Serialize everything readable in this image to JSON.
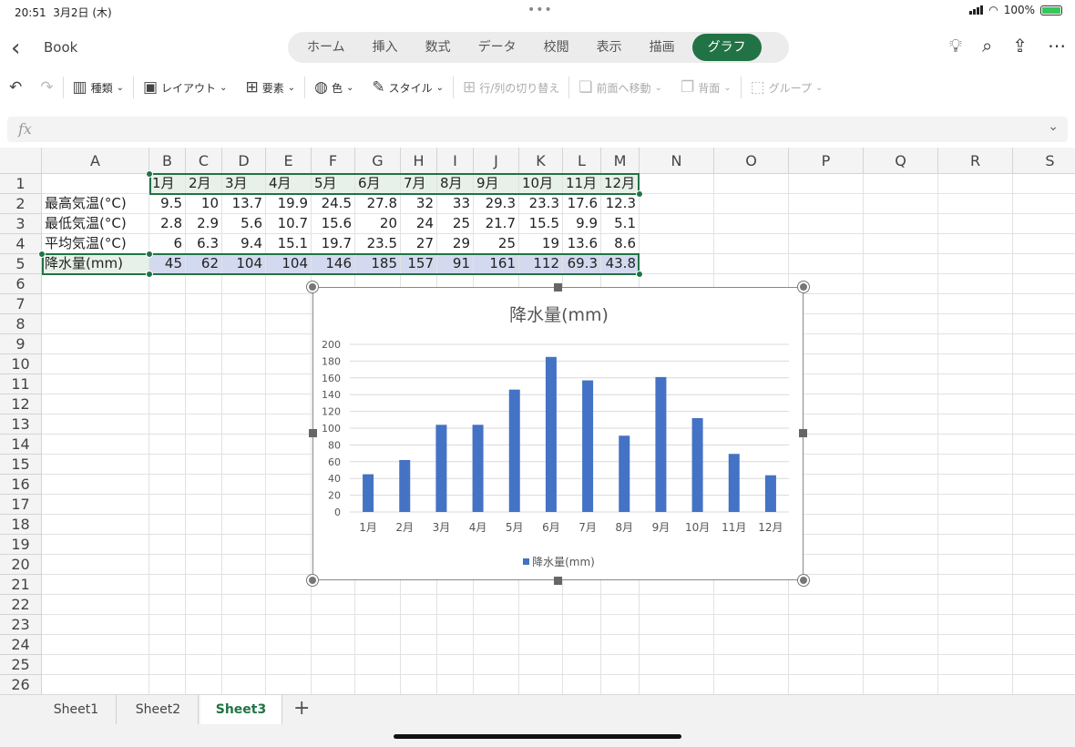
{
  "status": {
    "time": "20:51",
    "date": "3月2日 (木)",
    "battery": "100%",
    "dots": "•••"
  },
  "header": {
    "back_icon": "chevron-left-icon",
    "title": "Book",
    "tabs": [
      "ホーム",
      "挿入",
      "数式",
      "データ",
      "校閲",
      "表示",
      "描画",
      "グラフ"
    ],
    "active_tab": "グラフ",
    "right_icons": [
      "lightbulb-icon",
      "search-icon",
      "share-icon",
      "more-icon"
    ]
  },
  "ribbon": {
    "undo_icon": "undo-icon",
    "redo_icon": "redo-icon",
    "items": [
      {
        "label": "種類",
        "icon": "chart-type-icon",
        "enabled": true
      },
      {
        "label": "レイアウト",
        "icon": "layout-icon",
        "enabled": true
      },
      {
        "label": "要素",
        "icon": "elements-icon",
        "enabled": true
      },
      {
        "label": "色",
        "icon": "palette-icon",
        "enabled": true
      },
      {
        "label": "スタイル",
        "icon": "style-icon",
        "enabled": true
      },
      {
        "label": "行/列の切り替え",
        "icon": "switch-row-col-icon",
        "enabled": false
      },
      {
        "label": "前面へ移動",
        "icon": "bring-forward-icon",
        "enabled": false
      },
      {
        "label": "背面",
        "icon": "send-backward-icon",
        "enabled": false
      },
      {
        "label": "グループ",
        "icon": "group-icon",
        "enabled": false
      }
    ]
  },
  "formula_bar": {
    "fx_label": "fx",
    "value": ""
  },
  "grid": {
    "columns": [
      "A",
      "B",
      "C",
      "D",
      "E",
      "F",
      "G",
      "H",
      "I",
      "J",
      "K",
      "L",
      "M",
      "N",
      "O",
      "P",
      "Q",
      "R",
      "S"
    ],
    "row_count": 26,
    "cells": [
      [
        "",
        "1月",
        "2月",
        "3月",
        "4月",
        "5月",
        "6月",
        "7月",
        "8月",
        "9月",
        "10月",
        "11月",
        "12月"
      ],
      [
        "最高気温(°C)",
        "9.5",
        "10",
        "13.7",
        "19.9",
        "24.5",
        "27.8",
        "32",
        "33",
        "29.3",
        "23.3",
        "17.6",
        "12.3"
      ],
      [
        "最低気温(°C)",
        "2.8",
        "2.9",
        "5.6",
        "10.7",
        "15.6",
        "20",
        "24",
        "25",
        "21.7",
        "15.5",
        "9.9",
        "5.1"
      ],
      [
        "平均気温(°C)",
        "6",
        "6.3",
        "9.4",
        "15.1",
        "19.7",
        "23.5",
        "27",
        "29",
        "25",
        "19",
        "13.6",
        "8.6"
      ],
      [
        "降水量(mm)",
        "45",
        "62",
        "104",
        "104",
        "146",
        "185",
        "157",
        "91",
        "161",
        "112",
        "69.3",
        "43.8"
      ]
    ]
  },
  "chart_data": {
    "type": "bar",
    "title": "降水量(mm)",
    "categories": [
      "1月",
      "2月",
      "3月",
      "4月",
      "5月",
      "6月",
      "7月",
      "8月",
      "9月",
      "10月",
      "11月",
      "12月"
    ],
    "series": [
      {
        "name": "降水量(mm)",
        "values": [
          45,
          62,
          104,
          104,
          146,
          185,
          157,
          91,
          161,
          112,
          69.3,
          43.8
        ],
        "color": "#4472c4"
      }
    ],
    "ylim": [
      0,
      200
    ],
    "yticks": [
      "0",
      "20",
      "40",
      "60",
      "80",
      "100",
      "120",
      "140",
      "160",
      "180",
      "200"
    ],
    "grid": true,
    "legend": "bottom"
  },
  "sheets": {
    "tabs": [
      "Sheet1",
      "Sheet2",
      "Sheet3"
    ],
    "active": "Sheet3",
    "add_icon": "plus-icon"
  },
  "colors": {
    "accent": "#217346",
    "bar": "#4472c4",
    "header_sel": "#e8f1e9",
    "data_sel": "#d3d9ef"
  }
}
